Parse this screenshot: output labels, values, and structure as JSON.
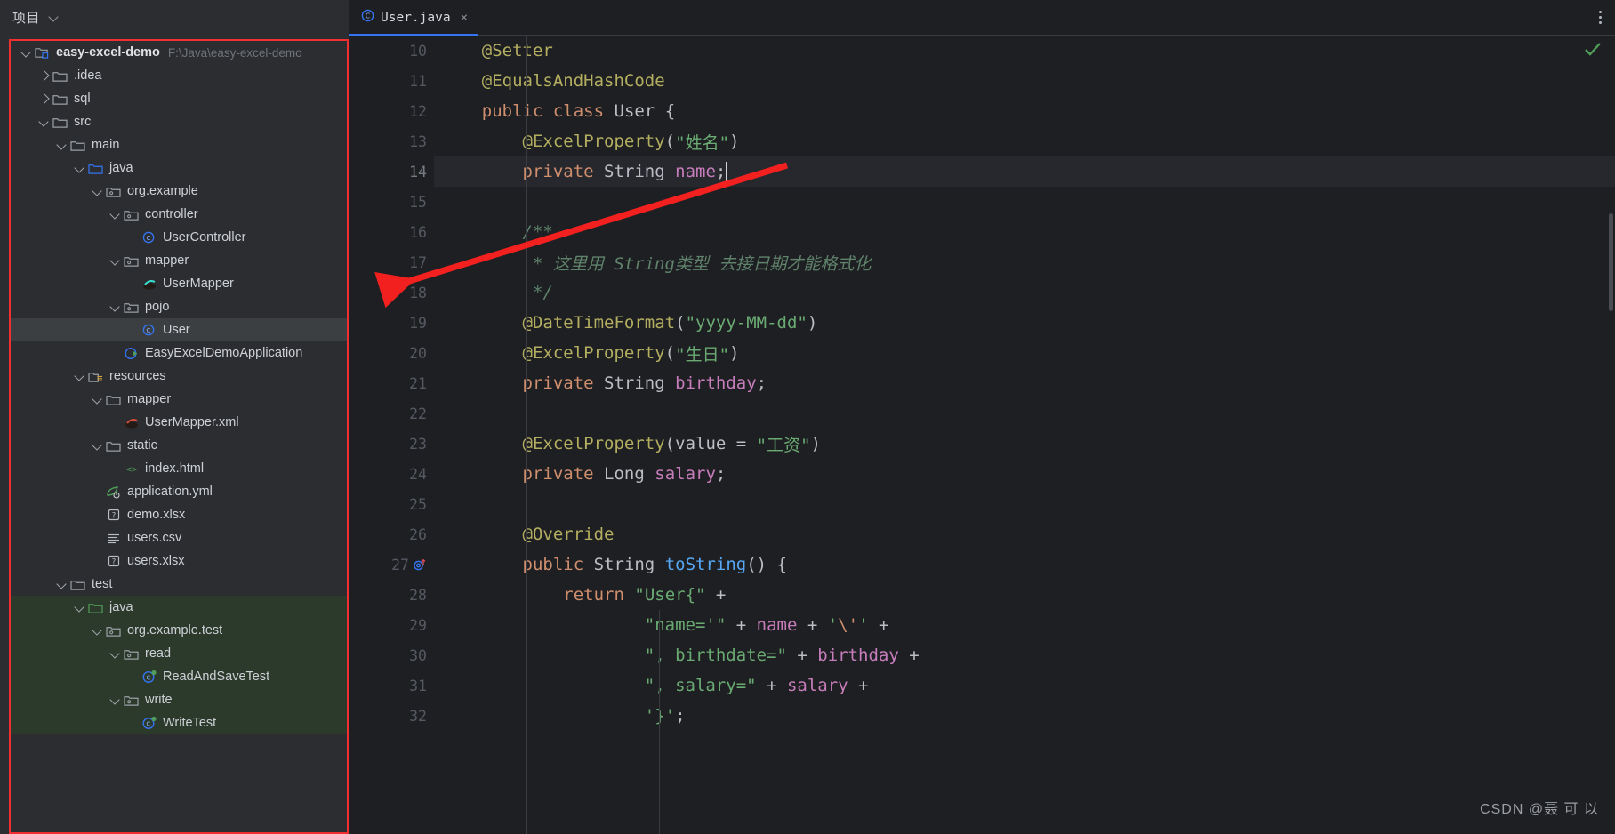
{
  "sidebar": {
    "header_title": "项目",
    "header_chevron_icon": "chevron-down-icon",
    "tree": [
      {
        "depth": 0,
        "arrow": "down",
        "icon": "module-folder-icon",
        "label": "easy-excel-demo",
        "bold": true,
        "path": "F:\\Java\\easy-excel-demo",
        "state": "normal"
      },
      {
        "depth": 1,
        "arrow": "right",
        "icon": "folder-icon",
        "label": ".idea",
        "bold": false,
        "path": "",
        "state": "normal"
      },
      {
        "depth": 1,
        "arrow": "right",
        "icon": "folder-icon",
        "label": "sql",
        "bold": false,
        "path": "",
        "state": "normal"
      },
      {
        "depth": 1,
        "arrow": "down",
        "icon": "folder-icon",
        "label": "src",
        "bold": false,
        "path": "",
        "state": "normal"
      },
      {
        "depth": 2,
        "arrow": "down",
        "icon": "folder-icon",
        "label": "main",
        "bold": false,
        "path": "",
        "state": "normal"
      },
      {
        "depth": 3,
        "arrow": "down",
        "icon": "source-root-folder-icon",
        "label": "java",
        "bold": false,
        "path": "",
        "state": "normal"
      },
      {
        "depth": 4,
        "arrow": "down",
        "icon": "package-icon",
        "label": "org.example",
        "bold": false,
        "path": "",
        "state": "normal"
      },
      {
        "depth": 5,
        "arrow": "down",
        "icon": "package-icon",
        "label": "controller",
        "bold": false,
        "path": "",
        "state": "normal"
      },
      {
        "depth": 6,
        "arrow": "none",
        "icon": "java-class-icon",
        "label": "UserController",
        "bold": false,
        "path": "",
        "state": "normal"
      },
      {
        "depth": 5,
        "arrow": "down",
        "icon": "package-icon",
        "label": "mapper",
        "bold": false,
        "path": "",
        "state": "normal"
      },
      {
        "depth": 6,
        "arrow": "none",
        "icon": "mybatis-mapper-icon",
        "label": "UserMapper",
        "bold": false,
        "path": "",
        "state": "normal"
      },
      {
        "depth": 5,
        "arrow": "down",
        "icon": "package-icon",
        "label": "pojo",
        "bold": false,
        "path": "",
        "state": "normal"
      },
      {
        "depth": 6,
        "arrow": "none",
        "icon": "java-class-icon",
        "label": "User",
        "bold": false,
        "path": "",
        "state": "selected"
      },
      {
        "depth": 5,
        "arrow": "none",
        "icon": "spring-boot-class-icon",
        "label": "EasyExcelDemoApplication",
        "bold": false,
        "path": "",
        "state": "normal"
      },
      {
        "depth": 3,
        "arrow": "down",
        "icon": "resources-root-folder-icon",
        "label": "resources",
        "bold": false,
        "path": "",
        "state": "normal"
      },
      {
        "depth": 4,
        "arrow": "down",
        "icon": "folder-icon",
        "label": "mapper",
        "bold": false,
        "path": "",
        "state": "normal"
      },
      {
        "depth": 5,
        "arrow": "none",
        "icon": "mybatis-xml-icon",
        "label": "UserMapper.xml",
        "bold": false,
        "path": "",
        "state": "normal"
      },
      {
        "depth": 4,
        "arrow": "down",
        "icon": "folder-icon",
        "label": "static",
        "bold": false,
        "path": "",
        "state": "normal"
      },
      {
        "depth": 5,
        "arrow": "none",
        "icon": "html-file-icon",
        "label": "index.html",
        "bold": false,
        "path": "",
        "state": "normal"
      },
      {
        "depth": 4,
        "arrow": "none",
        "icon": "spring-yaml-icon",
        "label": "application.yml",
        "bold": false,
        "path": "",
        "state": "normal"
      },
      {
        "depth": 4,
        "arrow": "none",
        "icon": "unknown-file-icon",
        "label": "demo.xlsx",
        "bold": false,
        "path": "",
        "state": "normal"
      },
      {
        "depth": 4,
        "arrow": "none",
        "icon": "csv-file-icon",
        "label": "users.csv",
        "bold": false,
        "path": "",
        "state": "normal"
      },
      {
        "depth": 4,
        "arrow": "none",
        "icon": "unknown-file-icon",
        "label": "users.xlsx",
        "bold": false,
        "path": "",
        "state": "normal"
      },
      {
        "depth": 2,
        "arrow": "down",
        "icon": "folder-icon",
        "label": "test",
        "bold": false,
        "path": "",
        "state": "normal"
      },
      {
        "depth": 3,
        "arrow": "down",
        "icon": "test-source-root-folder-icon",
        "label": "java",
        "bold": false,
        "path": "",
        "state": "green"
      },
      {
        "depth": 4,
        "arrow": "down",
        "icon": "package-icon",
        "label": "org.example.test",
        "bold": false,
        "path": "",
        "state": "green"
      },
      {
        "depth": 5,
        "arrow": "down",
        "icon": "package-icon",
        "label": "read",
        "bold": false,
        "path": "",
        "state": "green"
      },
      {
        "depth": 6,
        "arrow": "none",
        "icon": "java-test-class-icon",
        "label": "ReadAndSaveTest",
        "bold": false,
        "path": "",
        "state": "green"
      },
      {
        "depth": 5,
        "arrow": "down",
        "icon": "package-icon",
        "label": "write",
        "bold": false,
        "path": "",
        "state": "green"
      },
      {
        "depth": 6,
        "arrow": "none",
        "icon": "java-test-class-icon",
        "label": "WriteTest",
        "bold": false,
        "path": "",
        "state": "green"
      }
    ]
  },
  "editor": {
    "tab": {
      "icon": "java-class-icon",
      "label": "User.java",
      "close_label": "×"
    },
    "kebab_icon": "more-vertical-icon",
    "inspection_icon": "checkmark-ok-icon",
    "inspection_color": "#4f9d58",
    "lines": [
      {
        "num": "10",
        "gutter_icon": "",
        "current": false,
        "tokens": [
          {
            "t": "    ",
            "c": "t-pl"
          },
          {
            "t": "@Setter",
            "c": "t-ann"
          }
        ]
      },
      {
        "num": "11",
        "gutter_icon": "",
        "current": false,
        "tokens": [
          {
            "t": "    ",
            "c": "t-pl"
          },
          {
            "t": "@EqualsAndHashCode",
            "c": "t-ann"
          }
        ]
      },
      {
        "num": "12",
        "gutter_icon": "",
        "current": false,
        "tokens": [
          {
            "t": "    ",
            "c": "t-pl"
          },
          {
            "t": "public",
            "c": "t-kw"
          },
          {
            "t": " ",
            "c": "t-pl"
          },
          {
            "t": "class",
            "c": "t-kw"
          },
          {
            "t": " ",
            "c": "t-pl"
          },
          {
            "t": "User",
            "c": "t-cls"
          },
          {
            "t": " {",
            "c": "t-pl"
          }
        ]
      },
      {
        "num": "13",
        "gutter_icon": "",
        "current": false,
        "tokens": [
          {
            "t": "        ",
            "c": "t-pl"
          },
          {
            "t": "@ExcelProperty",
            "c": "t-ann"
          },
          {
            "t": "(",
            "c": "t-par"
          },
          {
            "t": "\"姓名\"",
            "c": "t-str"
          },
          {
            "t": ")",
            "c": "t-par"
          }
        ]
      },
      {
        "num": "14",
        "gutter_icon": "",
        "current": true,
        "tokens": [
          {
            "t": "        ",
            "c": "t-pl"
          },
          {
            "t": "private",
            "c": "t-kw"
          },
          {
            "t": " ",
            "c": "t-pl"
          },
          {
            "t": "String",
            "c": "t-cls"
          },
          {
            "t": " ",
            "c": "t-pl"
          },
          {
            "t": "name",
            "c": "t-fld"
          },
          {
            "t": ";",
            "c": "t-pl"
          }
        ]
      },
      {
        "num": "15",
        "gutter_icon": "",
        "current": false,
        "tokens": []
      },
      {
        "num": "16",
        "gutter_icon": "",
        "current": false,
        "tokens": [
          {
            "t": "        ",
            "c": "t-pl"
          },
          {
            "t": "/**",
            "c": "t-cmt"
          }
        ]
      },
      {
        "num": "17",
        "gutter_icon": "",
        "current": false,
        "tokens": [
          {
            "t": "         ",
            "c": "t-pl"
          },
          {
            "t": "* 这里用 String类型 去接日期才能格式化",
            "c": "t-cmt"
          }
        ]
      },
      {
        "num": "18",
        "gutter_icon": "",
        "current": false,
        "tokens": [
          {
            "t": "         ",
            "c": "t-pl"
          },
          {
            "t": "*/",
            "c": "t-cmt"
          }
        ]
      },
      {
        "num": "19",
        "gutter_icon": "",
        "current": false,
        "tokens": [
          {
            "t": "        ",
            "c": "t-pl"
          },
          {
            "t": "@DateTimeFormat",
            "c": "t-ann"
          },
          {
            "t": "(",
            "c": "t-par"
          },
          {
            "t": "\"yyyy-MM-dd\"",
            "c": "t-str"
          },
          {
            "t": ")",
            "c": "t-par"
          }
        ]
      },
      {
        "num": "20",
        "gutter_icon": "",
        "current": false,
        "tokens": [
          {
            "t": "        ",
            "c": "t-pl"
          },
          {
            "t": "@ExcelProperty",
            "c": "t-ann"
          },
          {
            "t": "(",
            "c": "t-par"
          },
          {
            "t": "\"生日\"",
            "c": "t-str"
          },
          {
            "t": ")",
            "c": "t-par"
          }
        ]
      },
      {
        "num": "21",
        "gutter_icon": "",
        "current": false,
        "tokens": [
          {
            "t": "        ",
            "c": "t-pl"
          },
          {
            "t": "private",
            "c": "t-kw"
          },
          {
            "t": " ",
            "c": "t-pl"
          },
          {
            "t": "String",
            "c": "t-cls"
          },
          {
            "t": " ",
            "c": "t-pl"
          },
          {
            "t": "birthday",
            "c": "t-fld"
          },
          {
            "t": ";",
            "c": "t-pl"
          }
        ]
      },
      {
        "num": "22",
        "gutter_icon": "",
        "current": false,
        "tokens": []
      },
      {
        "num": "23",
        "gutter_icon": "",
        "current": false,
        "tokens": [
          {
            "t": "        ",
            "c": "t-pl"
          },
          {
            "t": "@ExcelProperty",
            "c": "t-ann"
          },
          {
            "t": "(",
            "c": "t-par"
          },
          {
            "t": "value",
            "c": "t-pl"
          },
          {
            "t": " = ",
            "c": "t-pl"
          },
          {
            "t": "\"工资\"",
            "c": "t-str"
          },
          {
            "t": ")",
            "c": "t-par"
          }
        ]
      },
      {
        "num": "24",
        "gutter_icon": "",
        "current": false,
        "tokens": [
          {
            "t": "        ",
            "c": "t-pl"
          },
          {
            "t": "private",
            "c": "t-kw"
          },
          {
            "t": " ",
            "c": "t-pl"
          },
          {
            "t": "Long",
            "c": "t-cls"
          },
          {
            "t": " ",
            "c": "t-pl"
          },
          {
            "t": "salary",
            "c": "t-fld"
          },
          {
            "t": ";",
            "c": "t-pl"
          }
        ]
      },
      {
        "num": "25",
        "gutter_icon": "",
        "current": false,
        "tokens": []
      },
      {
        "num": "26",
        "gutter_icon": "",
        "current": false,
        "tokens": [
          {
            "t": "        ",
            "c": "t-pl"
          },
          {
            "t": "@Override",
            "c": "t-ann"
          }
        ]
      },
      {
        "num": "27",
        "gutter_icon": "override-method-icon",
        "current": false,
        "tokens": [
          {
            "t": "        ",
            "c": "t-pl"
          },
          {
            "t": "public",
            "c": "t-kw"
          },
          {
            "t": " ",
            "c": "t-pl"
          },
          {
            "t": "String",
            "c": "t-cls"
          },
          {
            "t": " ",
            "c": "t-pl"
          },
          {
            "t": "toString",
            "c": "t-mth"
          },
          {
            "t": "() {",
            "c": "t-pl"
          }
        ]
      },
      {
        "num": "28",
        "gutter_icon": "",
        "current": false,
        "tokens": [
          {
            "t": "            ",
            "c": "t-pl"
          },
          {
            "t": "return",
            "c": "t-kw"
          },
          {
            "t": " ",
            "c": "t-pl"
          },
          {
            "t": "\"User{\"",
            "c": "t-str"
          },
          {
            "t": " +",
            "c": "t-pl"
          }
        ]
      },
      {
        "num": "29",
        "gutter_icon": "",
        "current": false,
        "tokens": [
          {
            "t": "                    ",
            "c": "t-pl"
          },
          {
            "t": "\"name='\"",
            "c": "t-str"
          },
          {
            "t": " + ",
            "c": "t-pl"
          },
          {
            "t": "name",
            "c": "t-fld"
          },
          {
            "t": " + ",
            "c": "t-pl"
          },
          {
            "t": "'",
            "c": "t-str"
          },
          {
            "t": "\\'",
            "c": "t-esc"
          },
          {
            "t": "'",
            "c": "t-str"
          },
          {
            "t": " +",
            "c": "t-pl"
          }
        ]
      },
      {
        "num": "30",
        "gutter_icon": "",
        "current": false,
        "tokens": [
          {
            "t": "                    ",
            "c": "t-pl"
          },
          {
            "t": "\", birthdate=\"",
            "c": "t-str"
          },
          {
            "t": " + ",
            "c": "t-pl"
          },
          {
            "t": "birthday",
            "c": "t-fld"
          },
          {
            "t": " +",
            "c": "t-pl"
          }
        ]
      },
      {
        "num": "31",
        "gutter_icon": "",
        "current": false,
        "tokens": [
          {
            "t": "                    ",
            "c": "t-pl"
          },
          {
            "t": "\", salary=\"",
            "c": "t-str"
          },
          {
            "t": " + ",
            "c": "t-pl"
          },
          {
            "t": "salary",
            "c": "t-fld"
          },
          {
            "t": " +",
            "c": "t-pl"
          }
        ]
      },
      {
        "num": "32",
        "gutter_icon": "",
        "current": false,
        "tokens": [
          {
            "t": "                    ",
            "c": "t-pl"
          },
          {
            "t": "'}'",
            "c": "t-str"
          },
          {
            "t": ";",
            "c": "t-pl"
          }
        ]
      }
    ]
  },
  "annotation": {
    "arrow_color": "#f32020",
    "arrow_label": "red-arrow-annotation"
  },
  "watermark": {
    "text": "CSDN @聂 可 以"
  },
  "colors": {
    "sidebar_bg": "#2b2d30",
    "editor_bg": "#1e1f22",
    "selection": "#3c3f41",
    "test_green": "#2c3a2c",
    "tab_accent": "#3574f0",
    "frame_red": "#f03030"
  }
}
